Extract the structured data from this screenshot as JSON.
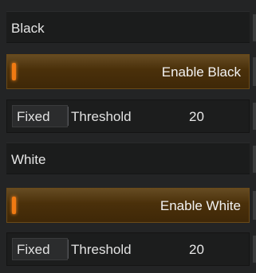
{
  "black": {
    "header": "Black",
    "toggle_label": "Enable Black",
    "mode_label": "Fixed",
    "threshold_label": "Threshold",
    "threshold_value": "20"
  },
  "white": {
    "header": "White",
    "toggle_label": "Enable White",
    "mode_label": "Fixed",
    "threshold_label": "Threshold",
    "threshold_value": "20"
  },
  "colors": {
    "background": "#232425",
    "accent": "#f07a12",
    "toggle_bg": "#4a300a",
    "text": "#e6e6e6"
  }
}
